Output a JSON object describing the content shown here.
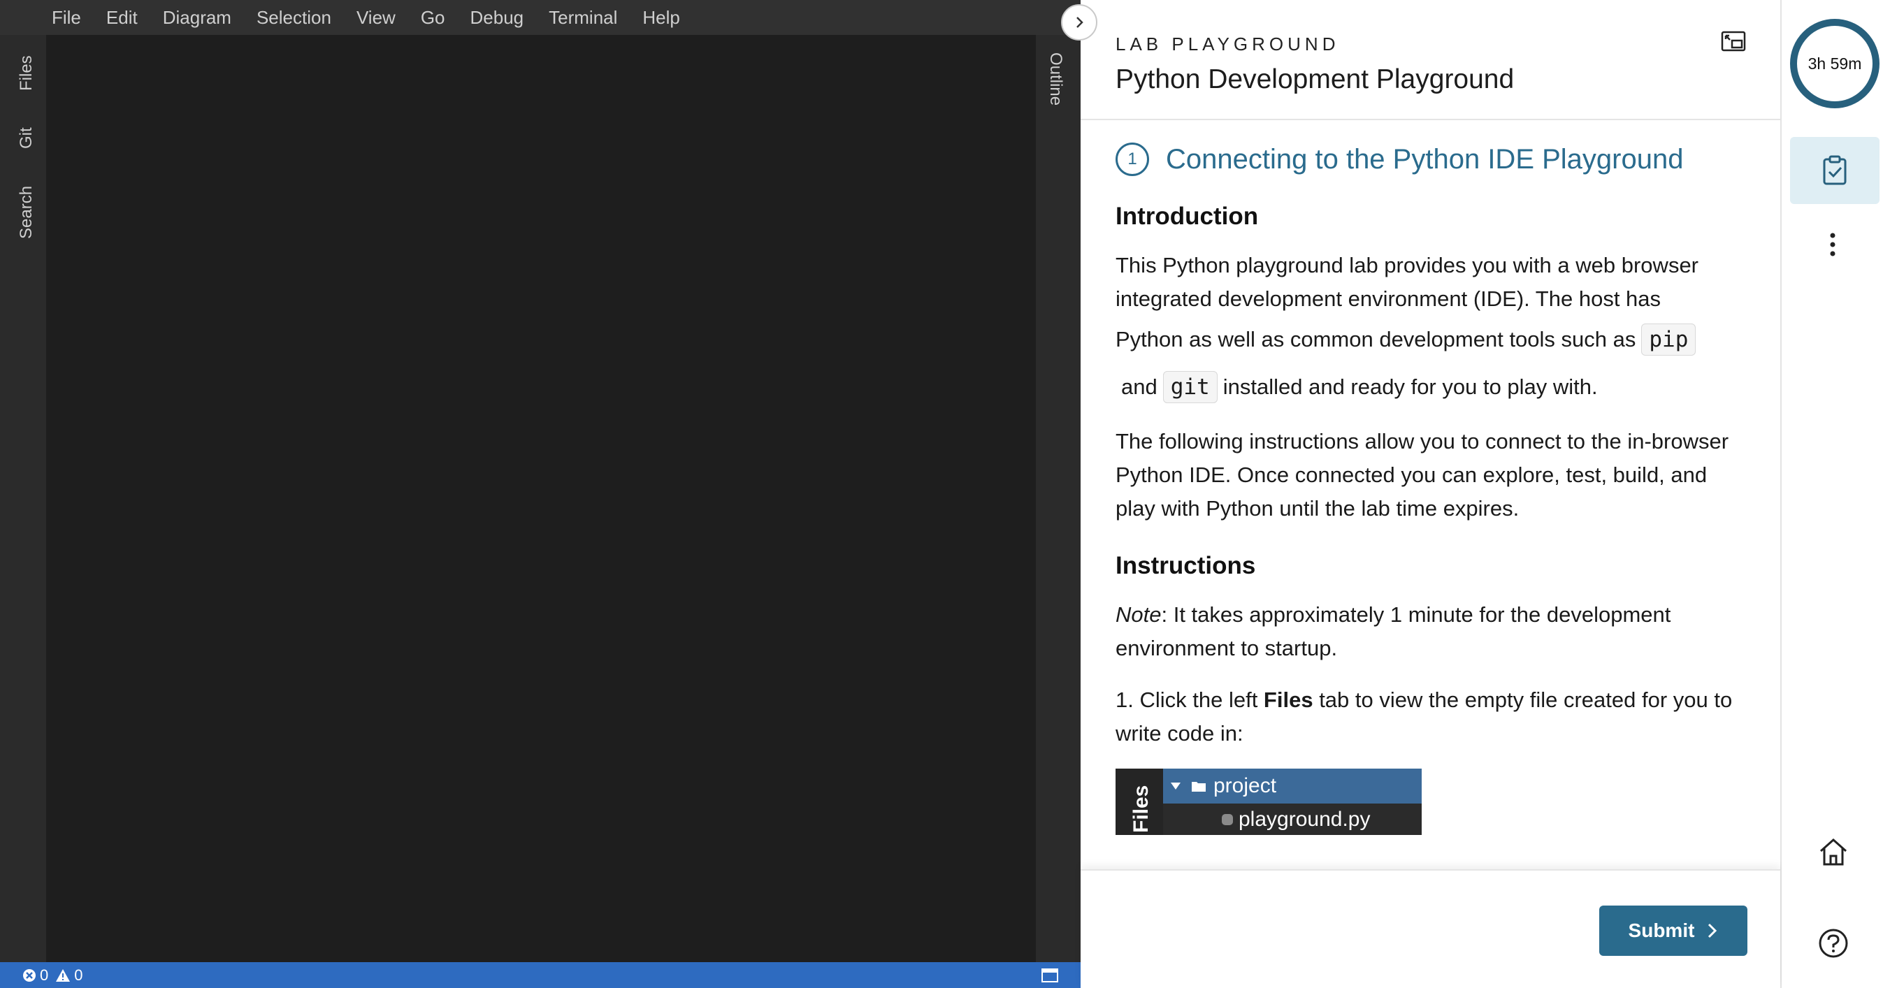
{
  "ide": {
    "menu": [
      "File",
      "Edit",
      "Diagram",
      "Selection",
      "View",
      "Go",
      "Debug",
      "Terminal",
      "Help"
    ],
    "left_tabs": [
      "Files",
      "Git",
      "Search"
    ],
    "right_tab": "Outline",
    "status": {
      "errors": "0",
      "warnings": "0"
    }
  },
  "lab": {
    "kicker": "LAB PLAYGROUND",
    "title": "Python Development Playground",
    "step": {
      "number": "1",
      "title": "Connecting to the Python IDE Playground"
    },
    "intro": {
      "heading": "Introduction",
      "p1_line1": "This Python playground lab provides you with a web browser",
      "p1_line2": "integrated development environment (IDE). The host has",
      "p1_line3": "Python as well as common development tools such as",
      "code_pip": "pip",
      "p1_and": "and",
      "code_git": "git",
      "p1_end": "installed and ready for you to play with.",
      "p2": "The following instructions allow you to connect to the in-browser Python IDE. Once connected you can explore, test, build, and play with Python until the lab time expires."
    },
    "instructions": {
      "heading": "Instructions",
      "note_label": "Note",
      "note_text": ": It takes approximately 1 minute for the development environment to startup.",
      "step1_pre": "1. Click the left ",
      "step1_bold": "Files",
      "step1_post": " tab to view the empty file created for you to write code in:"
    },
    "screenshot": {
      "files_label": "Files",
      "folder": "project",
      "file": "playground.py"
    },
    "submit_label": "Submit"
  },
  "rail": {
    "timer": "3h 59m"
  },
  "colors": {
    "accent": "#2a6b8d",
    "status_bar": "#2e6bc0",
    "ide_bg": "#1e1e1e"
  }
}
